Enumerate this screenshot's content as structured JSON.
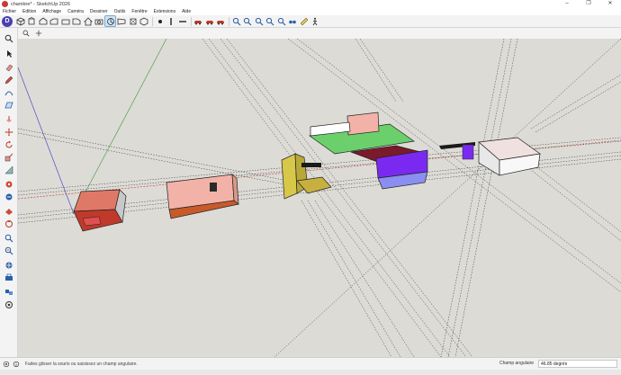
{
  "window": {
    "title": "chambre* - SketchUp 2026",
    "minimize": "–",
    "maximize": "❐",
    "close": "✕"
  },
  "menu": {
    "items": [
      "Fichier",
      "Edition",
      "Affichage",
      "Caméra",
      "Dessiner",
      "Outils",
      "Fenêtre",
      "Extensions",
      "Aide"
    ]
  },
  "toolbar": {
    "brand": "D",
    "buttons": [
      {
        "name": "iso-view-icon"
      },
      {
        "name": "top-view-icon"
      },
      {
        "name": "front-view-icon"
      },
      {
        "name": "right-view-icon"
      },
      {
        "name": "back-view-icon"
      },
      {
        "name": "left-view-icon"
      },
      {
        "name": "home-icon"
      },
      {
        "name": "camera-icon"
      },
      {
        "name": "field-of-view-icon",
        "active": true
      },
      {
        "name": "perspective-icon"
      },
      {
        "name": "xray-icon"
      },
      {
        "name": "wireframe-icon"
      },
      {
        "name": "dot-icon"
      },
      {
        "name": "line-icon"
      },
      {
        "name": "bar-icon"
      },
      {
        "name": "car-icon"
      },
      {
        "name": "car-icon-2"
      },
      {
        "name": "car-icon-3"
      },
      {
        "name": "magnify-icon"
      },
      {
        "name": "magnify-icon-2"
      },
      {
        "name": "magnify-icon-3"
      },
      {
        "name": "magnify-icon-4"
      },
      {
        "name": "magnify-icon-5"
      },
      {
        "name": "glasses-icon"
      },
      {
        "name": "ruler-icon"
      },
      {
        "name": "walk-icon"
      }
    ]
  },
  "status": {
    "hint": "Faites glisser la souris ou saisissez un champ angulaire.",
    "measure_label": "Champ angulaire",
    "measure_value": "46.85 degrés"
  },
  "colors": {
    "viewport_bg": "#dcdbd6",
    "axis_red": "#c0392b",
    "axis_green": "#3a9a3a",
    "axis_blue": "#3a3ac0",
    "brand": "#4a3fb0",
    "active_tool": "#cfe3f3"
  }
}
